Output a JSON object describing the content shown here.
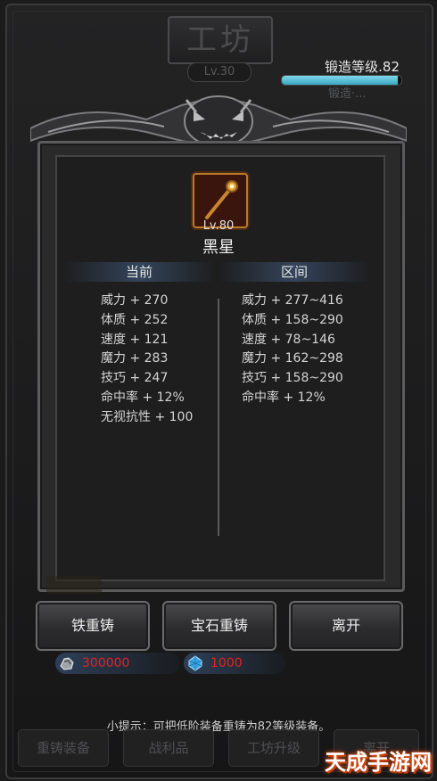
{
  "header": {
    "title": "工坊",
    "level": "Lv.30",
    "forge_label": "锻造等级.82",
    "forge_progress": 0.97,
    "forge_sub": "锻造·..."
  },
  "item": {
    "level": "Lv.80",
    "name": "黑星"
  },
  "stats": {
    "current_header": "当前",
    "range_header": "区间",
    "current": [
      "威力 + 270",
      "体质 + 252",
      "速度 + 121",
      "魔力 + 283",
      "技巧 + 247",
      "命中率 + 12%",
      "无视抗性 + 100"
    ],
    "range": [
      "威力 + 277~416",
      "体质 + 158~290",
      "速度 + 78~146",
      "魔力 + 162~298",
      "技巧 + 158~290",
      "命中率 + 12%"
    ]
  },
  "buttons": {
    "iron_recast": "铁重铸",
    "gem_recast": "宝石重铸",
    "leave": "离开"
  },
  "resources": {
    "iron": "300000",
    "gem": "1000"
  },
  "tip": "小提示：可把低阶装备重铸为82等级装备。",
  "tabs": [
    "重铸装备",
    "战利品",
    "工坊升级",
    "离开"
  ],
  "watermark": "天成手游网",
  "colors": {
    "forge_bar": "#5cc3d8",
    "resource_text": "#e0241f",
    "item_frame": "#b97a2a"
  }
}
